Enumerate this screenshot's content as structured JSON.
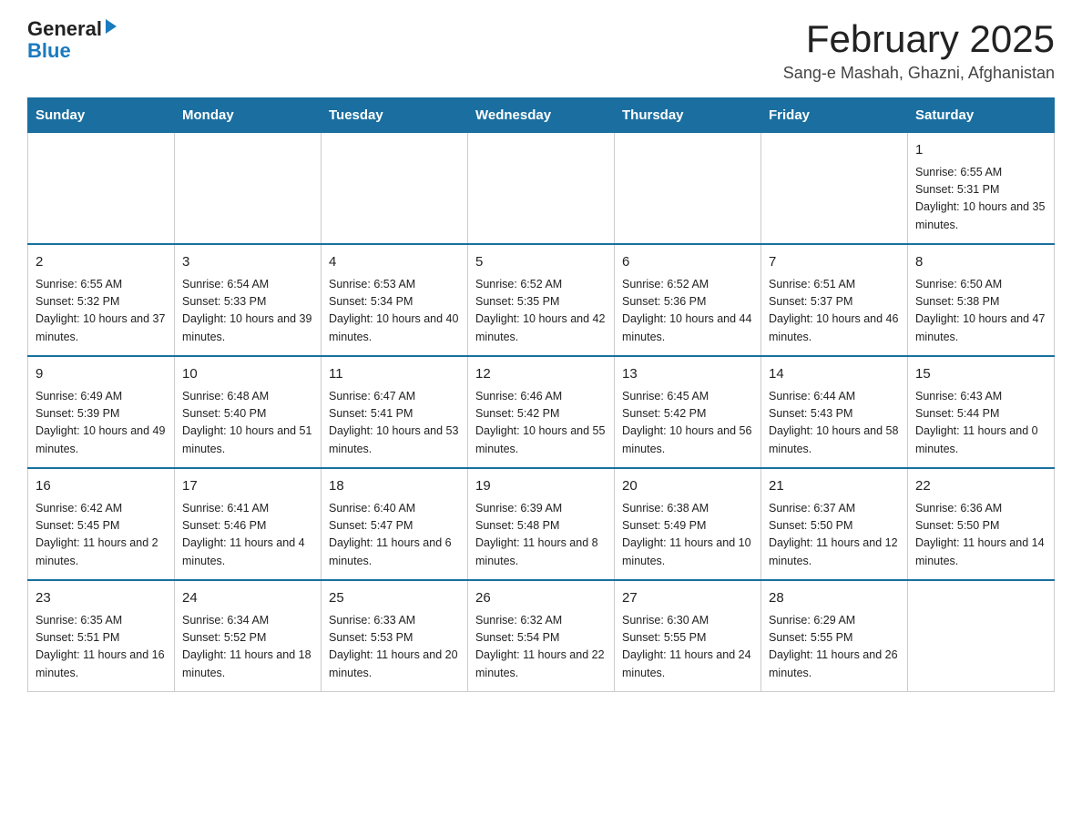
{
  "header": {
    "logo_general": "General",
    "logo_blue": "Blue",
    "month_title": "February 2025",
    "location": "Sang-e Mashah, Ghazni, Afghanistan"
  },
  "weekdays": [
    "Sunday",
    "Monday",
    "Tuesday",
    "Wednesday",
    "Thursday",
    "Friday",
    "Saturday"
  ],
  "weeks": [
    [
      {
        "day": "",
        "info": ""
      },
      {
        "day": "",
        "info": ""
      },
      {
        "day": "",
        "info": ""
      },
      {
        "day": "",
        "info": ""
      },
      {
        "day": "",
        "info": ""
      },
      {
        "day": "",
        "info": ""
      },
      {
        "day": "1",
        "info": "Sunrise: 6:55 AM\nSunset: 5:31 PM\nDaylight: 10 hours and 35 minutes."
      }
    ],
    [
      {
        "day": "2",
        "info": "Sunrise: 6:55 AM\nSunset: 5:32 PM\nDaylight: 10 hours and 37 minutes."
      },
      {
        "day": "3",
        "info": "Sunrise: 6:54 AM\nSunset: 5:33 PM\nDaylight: 10 hours and 39 minutes."
      },
      {
        "day": "4",
        "info": "Sunrise: 6:53 AM\nSunset: 5:34 PM\nDaylight: 10 hours and 40 minutes."
      },
      {
        "day": "5",
        "info": "Sunrise: 6:52 AM\nSunset: 5:35 PM\nDaylight: 10 hours and 42 minutes."
      },
      {
        "day": "6",
        "info": "Sunrise: 6:52 AM\nSunset: 5:36 PM\nDaylight: 10 hours and 44 minutes."
      },
      {
        "day": "7",
        "info": "Sunrise: 6:51 AM\nSunset: 5:37 PM\nDaylight: 10 hours and 46 minutes."
      },
      {
        "day": "8",
        "info": "Sunrise: 6:50 AM\nSunset: 5:38 PM\nDaylight: 10 hours and 47 minutes."
      }
    ],
    [
      {
        "day": "9",
        "info": "Sunrise: 6:49 AM\nSunset: 5:39 PM\nDaylight: 10 hours and 49 minutes."
      },
      {
        "day": "10",
        "info": "Sunrise: 6:48 AM\nSunset: 5:40 PM\nDaylight: 10 hours and 51 minutes."
      },
      {
        "day": "11",
        "info": "Sunrise: 6:47 AM\nSunset: 5:41 PM\nDaylight: 10 hours and 53 minutes."
      },
      {
        "day": "12",
        "info": "Sunrise: 6:46 AM\nSunset: 5:42 PM\nDaylight: 10 hours and 55 minutes."
      },
      {
        "day": "13",
        "info": "Sunrise: 6:45 AM\nSunset: 5:42 PM\nDaylight: 10 hours and 56 minutes."
      },
      {
        "day": "14",
        "info": "Sunrise: 6:44 AM\nSunset: 5:43 PM\nDaylight: 10 hours and 58 minutes."
      },
      {
        "day": "15",
        "info": "Sunrise: 6:43 AM\nSunset: 5:44 PM\nDaylight: 11 hours and 0 minutes."
      }
    ],
    [
      {
        "day": "16",
        "info": "Sunrise: 6:42 AM\nSunset: 5:45 PM\nDaylight: 11 hours and 2 minutes."
      },
      {
        "day": "17",
        "info": "Sunrise: 6:41 AM\nSunset: 5:46 PM\nDaylight: 11 hours and 4 minutes."
      },
      {
        "day": "18",
        "info": "Sunrise: 6:40 AM\nSunset: 5:47 PM\nDaylight: 11 hours and 6 minutes."
      },
      {
        "day": "19",
        "info": "Sunrise: 6:39 AM\nSunset: 5:48 PM\nDaylight: 11 hours and 8 minutes."
      },
      {
        "day": "20",
        "info": "Sunrise: 6:38 AM\nSunset: 5:49 PM\nDaylight: 11 hours and 10 minutes."
      },
      {
        "day": "21",
        "info": "Sunrise: 6:37 AM\nSunset: 5:50 PM\nDaylight: 11 hours and 12 minutes."
      },
      {
        "day": "22",
        "info": "Sunrise: 6:36 AM\nSunset: 5:50 PM\nDaylight: 11 hours and 14 minutes."
      }
    ],
    [
      {
        "day": "23",
        "info": "Sunrise: 6:35 AM\nSunset: 5:51 PM\nDaylight: 11 hours and 16 minutes."
      },
      {
        "day": "24",
        "info": "Sunrise: 6:34 AM\nSunset: 5:52 PM\nDaylight: 11 hours and 18 minutes."
      },
      {
        "day": "25",
        "info": "Sunrise: 6:33 AM\nSunset: 5:53 PM\nDaylight: 11 hours and 20 minutes."
      },
      {
        "day": "26",
        "info": "Sunrise: 6:32 AM\nSunset: 5:54 PM\nDaylight: 11 hours and 22 minutes."
      },
      {
        "day": "27",
        "info": "Sunrise: 6:30 AM\nSunset: 5:55 PM\nDaylight: 11 hours and 24 minutes."
      },
      {
        "day": "28",
        "info": "Sunrise: 6:29 AM\nSunset: 5:55 PM\nDaylight: 11 hours and 26 minutes."
      },
      {
        "day": "",
        "info": ""
      }
    ]
  ]
}
